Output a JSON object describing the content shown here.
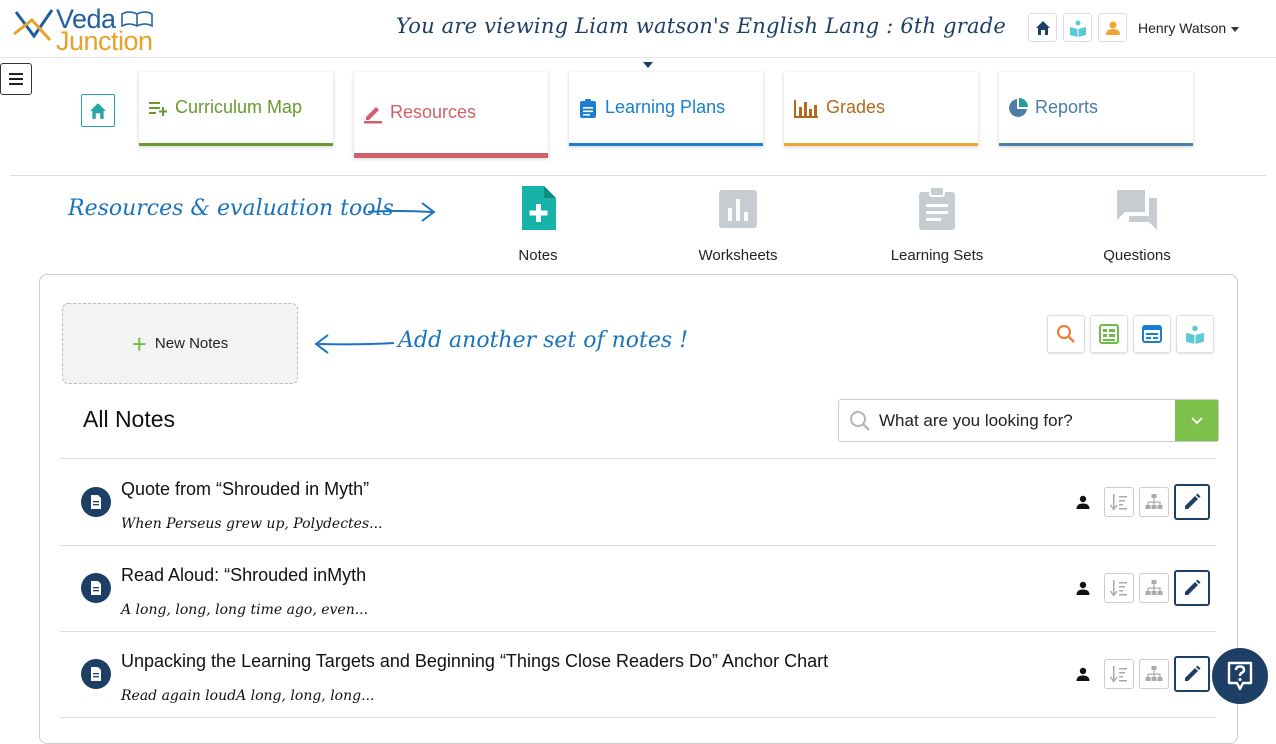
{
  "header": {
    "logo_line1": "Veda",
    "logo_line2": "Junction",
    "title": "You are viewing Liam watson's English Lang : 6th grade",
    "user_name": "Henry Watson"
  },
  "nav": {
    "tabs": [
      {
        "label": "Curriculum Map",
        "color": "#6a9a2f"
      },
      {
        "label": "Resources",
        "color": "#d1606a"
      },
      {
        "label": "Learning Plans",
        "color": "#1a7fd0"
      },
      {
        "label": "Grades",
        "color": "#b3691e"
      },
      {
        "label": "Reports",
        "color": "#4a7ea6"
      }
    ]
  },
  "tools": {
    "annotation": "Resources & evaluation tools",
    "items": [
      {
        "label": "Notes"
      },
      {
        "label": "Worksheets"
      },
      {
        "label": "Learning Sets"
      },
      {
        "label": "Questions"
      }
    ]
  },
  "panel": {
    "new_notes_label": "New Notes",
    "annotation": "Add another set of notes !",
    "heading": "All Notes",
    "search_placeholder": "What are you looking for?",
    "notes": [
      {
        "title": "Quote from “Shrouded in Myth”",
        "excerpt": "When Perseus grew up, Polydectes..."
      },
      {
        "title": "Read Aloud: “Shrouded inMyth",
        "excerpt": "A long, long, long time ago, even..."
      },
      {
        "title": "Unpacking the Learning Targets and Beginning “Things Close Readers Do” Anchor Chart",
        "excerpt": "Read again loudA long, long, long..."
      }
    ]
  },
  "colors": {
    "navy": "#1d3f66",
    "teal": "#26a6a6",
    "green": "#7dc14a",
    "annotation_blue": "#1a73bd"
  }
}
